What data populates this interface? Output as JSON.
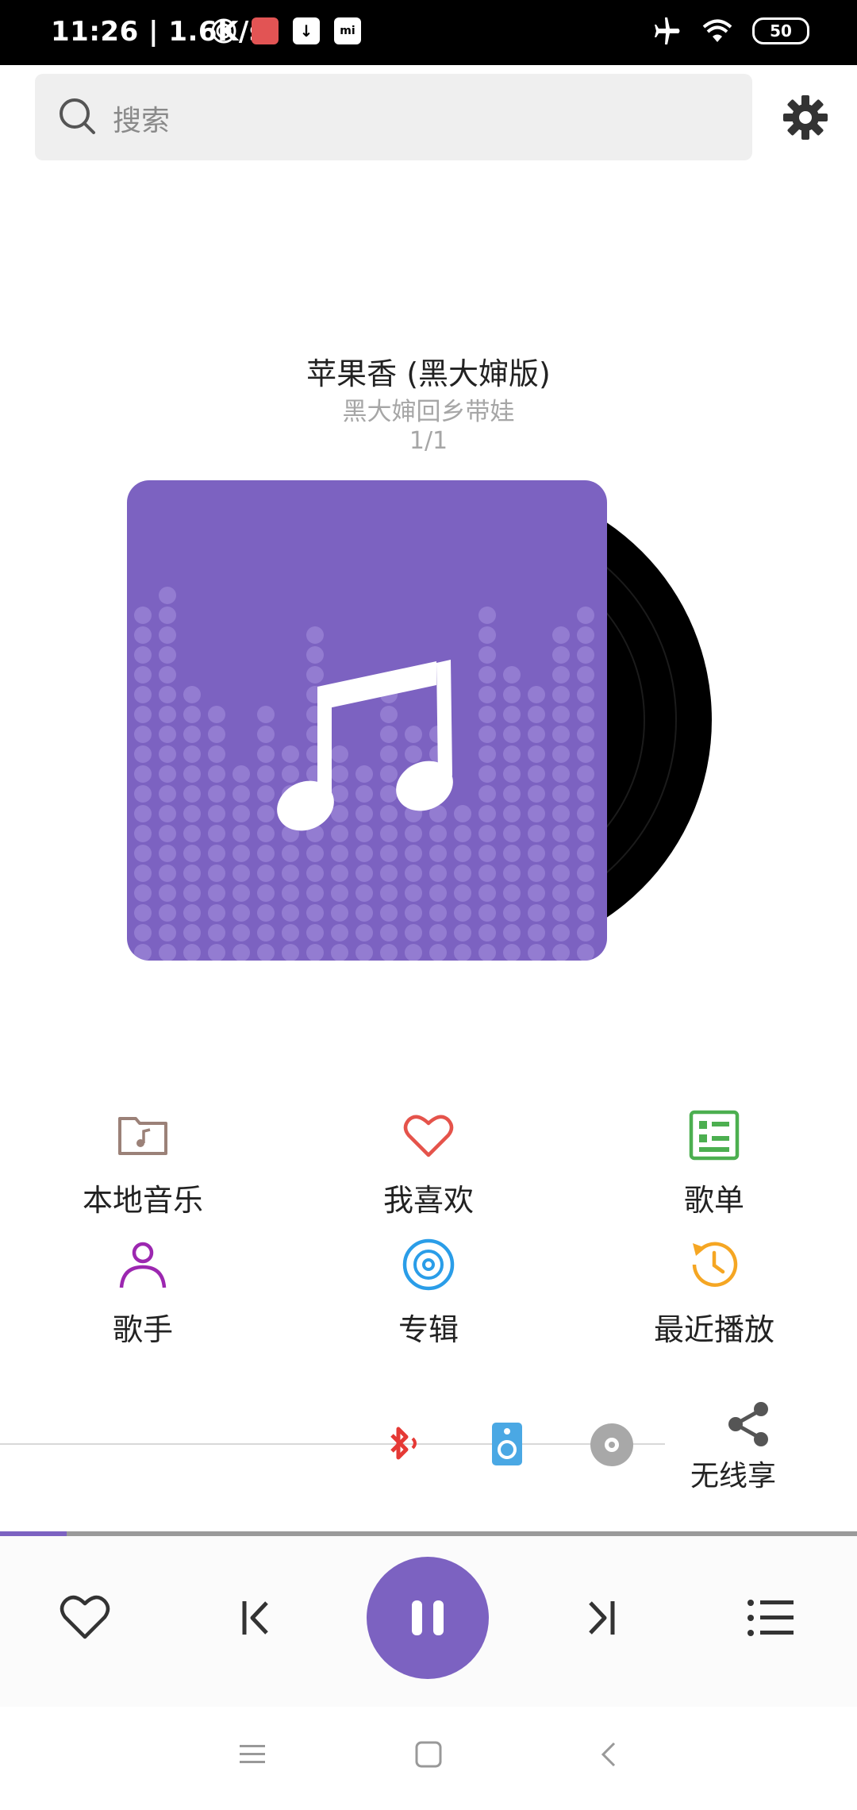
{
  "status_bar": {
    "time": "11:26",
    "speed": "1.6K/s",
    "battery": "50"
  },
  "search": {
    "placeholder": "搜索"
  },
  "now_playing": {
    "title": "苹果香 (黑大婶版)",
    "artist": "黑大婶回乡带娃",
    "index": "1/1"
  },
  "menu": {
    "items": [
      {
        "label": "本地音乐",
        "icon": "music-folder-icon",
        "color": "#9b8178"
      },
      {
        "label": "我喜欢",
        "icon": "heart-icon",
        "color": "#e5534b"
      },
      {
        "label": "歌单",
        "icon": "playlist-icon",
        "color": "#4caf50"
      },
      {
        "label": "歌手",
        "icon": "person-icon",
        "color": "#9c27b0"
      },
      {
        "label": "专辑",
        "icon": "album-disc-icon",
        "color": "#2a9de8"
      },
      {
        "label": "最近播放",
        "icon": "history-icon",
        "color": "#f5a623"
      }
    ]
  },
  "wireless": {
    "label": "无线享"
  },
  "player": {
    "progress": 0.078
  },
  "colors": {
    "accent": "#7c62c1"
  }
}
